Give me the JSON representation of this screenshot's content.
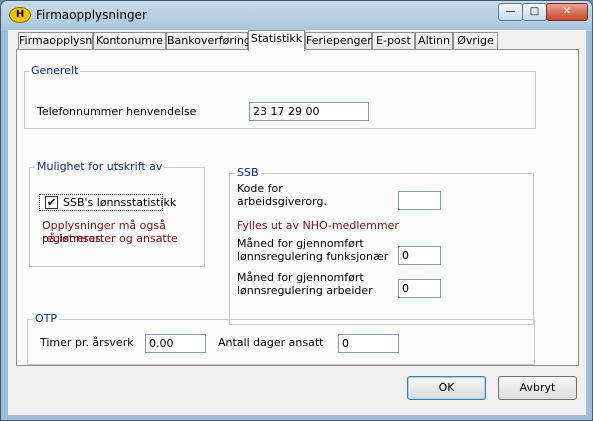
{
  "window": {
    "title": "Firmaopplysninger",
    "icon": "app-logo-icon"
  },
  "tabs": [
    {
      "label": "Firmaopplysn."
    },
    {
      "label": "Kontonumre"
    },
    {
      "label": "Bankoverføring"
    },
    {
      "label": "Statistikk",
      "active": true
    },
    {
      "label": "Feriepenger"
    },
    {
      "label": "E-post"
    },
    {
      "label": "Altinn"
    },
    {
      "label": "Øvrige"
    }
  ],
  "generelt": {
    "legend": "Generelt",
    "phone_label": "Telefonnummer henvendelse",
    "phone_value": "23 17 29 00"
  },
  "print": {
    "legend": "Mulighet for utskrift av",
    "checkbox_label": "SSB's lønnsstatistikk",
    "checked": true,
    "note_line1": "Opplysninger må også registreres",
    "note_line2": "på lønnsarter og ansatte"
  },
  "ssb": {
    "legend": "SSB",
    "kode_line1": "Kode for",
    "kode_line2": "arbeidsgiverorg.",
    "kode_value": "",
    "nho_note": "Fylles ut av NHO-medlemmer",
    "funk_line1": "Måned for gjennomført",
    "funk_line2": "lønnsregulering funksjonær",
    "funk_value": "0",
    "arb_line1": "Måned for gjennomført",
    "arb_line2": "lønnsregulering arbeider",
    "arb_value": "0"
  },
  "otp": {
    "legend": "OTP",
    "timer_label": "Timer pr. årsverk",
    "timer_value": "0.00",
    "dager_label": "Antall dager ansatt",
    "dager_value": "0"
  },
  "buttons": {
    "ok": "OK",
    "cancel": "Avbryt"
  }
}
